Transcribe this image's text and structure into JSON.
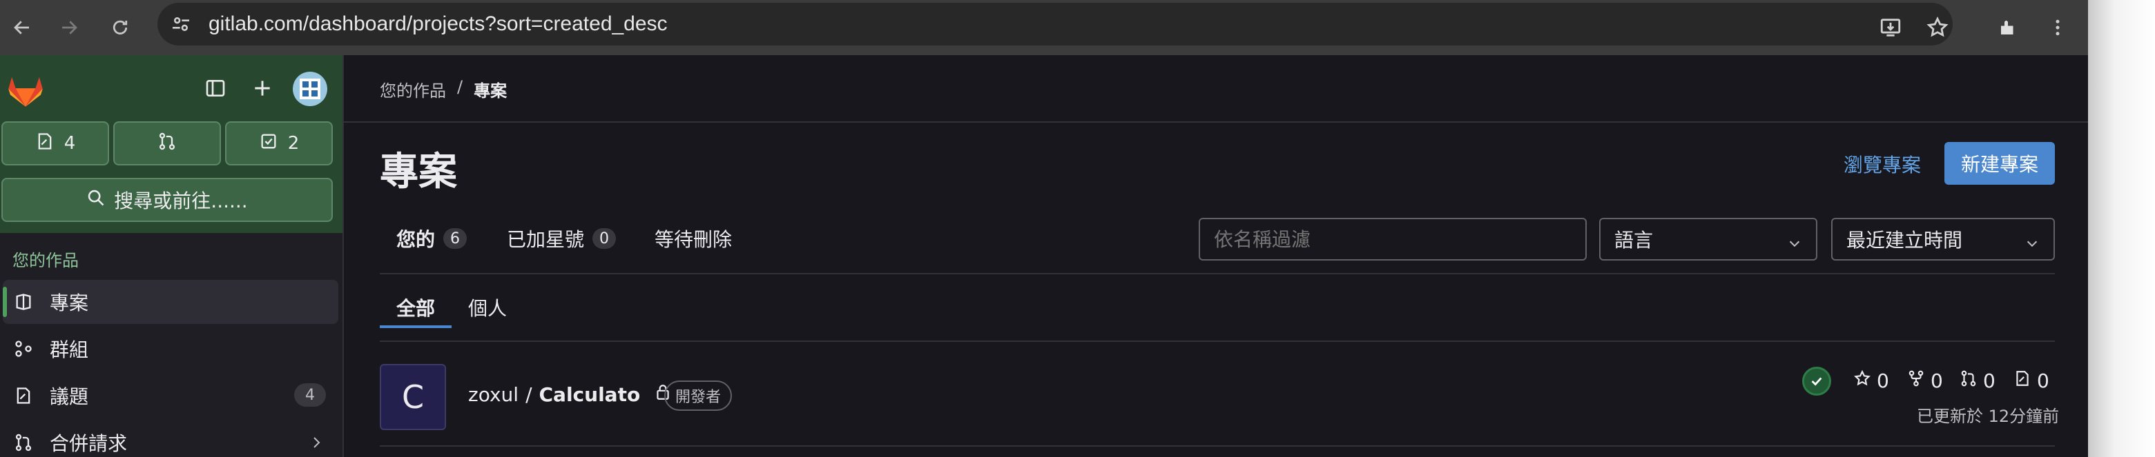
{
  "browser": {
    "url": "gitlab.com/dashboard/projects?sort=created_desc",
    "icons": [
      "back-icon",
      "forward-icon",
      "reload-icon",
      "site-info-icon",
      "install-app-icon",
      "bookmark-star-icon",
      "extensions-icon",
      "menu-icon"
    ]
  },
  "sidebar": {
    "counters": {
      "issues": "4",
      "todos": "2"
    },
    "search_label": "搜尋或前往......",
    "section_label": "您的作品",
    "items": [
      {
        "label": "專案",
        "icon": "project-icon"
      },
      {
        "label": "群組",
        "icon": "group-icon"
      },
      {
        "label": "議題",
        "icon": "issues-icon",
        "badge": "4"
      },
      {
        "label": "合併請求",
        "icon": "merge-request-icon"
      }
    ]
  },
  "main": {
    "breadcrumb": {
      "parent": "您的作品",
      "separator": "/",
      "current": "專案"
    },
    "title": "專案",
    "browse_label": "瀏覽專案",
    "new_label": "新建專案",
    "tabs": [
      {
        "label": "您的",
        "count": "6"
      },
      {
        "label": "已加星號",
        "count": "0"
      },
      {
        "label": "等待刪除"
      }
    ],
    "filter_placeholder": "依名稱過濾",
    "language_select": "語言",
    "sort_select": "最近建立時間",
    "subtabs": [
      "全部",
      "個人"
    ],
    "project": {
      "avatar_letter": "C",
      "namespace": "zoxul",
      "separator": "/",
      "name": "Calculato",
      "role": "開發者",
      "stars": "0",
      "forks": "0",
      "merge_requests": "0",
      "issues": "0",
      "updated": "已更新於 12分鐘前"
    }
  },
  "colors": {
    "sidebar_header": "#27472e",
    "accent_blue": "#4a87cf",
    "link_blue": "#63a6e9",
    "status_green": "#2e7d46"
  }
}
